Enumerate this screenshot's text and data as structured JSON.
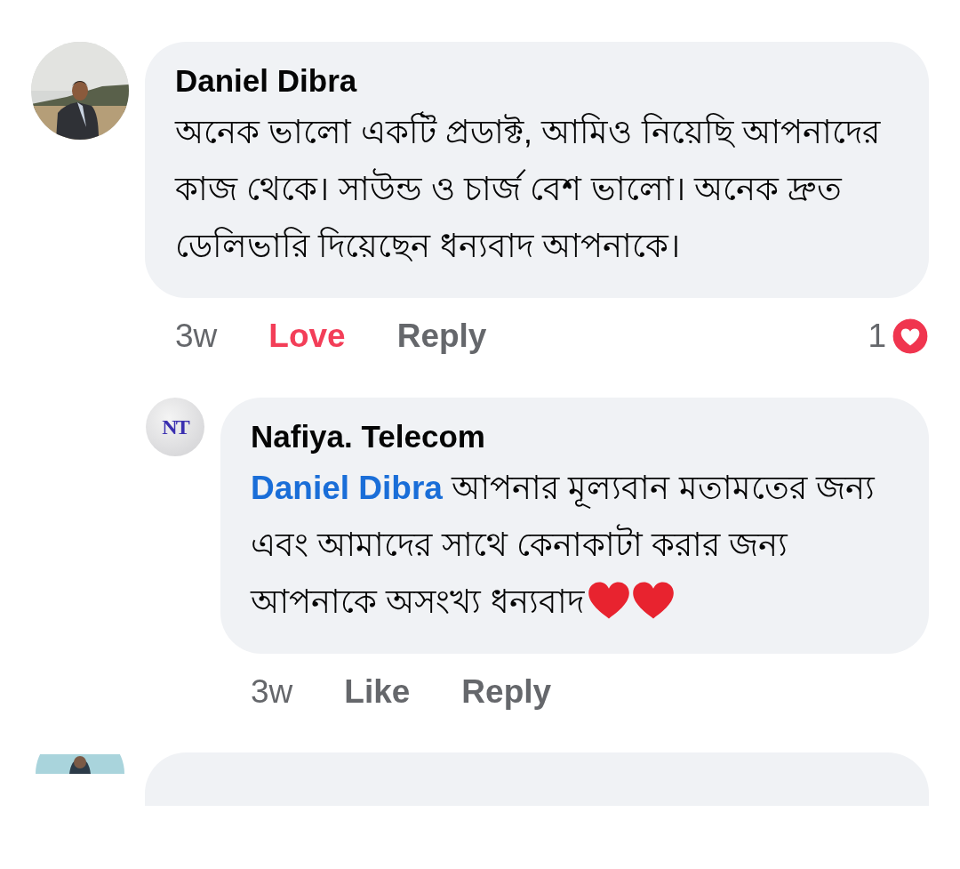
{
  "comment": {
    "author": "Daniel Dibra",
    "text": "অনেক ভালো একটি প্রডাক্ট, আমিও নিয়েছি আপনাদের কাজ থেকে। সাউন্ড ও চার্জ বেশ ভালো। অনেক দ্রুত ডেলিভারি দিয়েছেন ধন্যবাদ আপনাকে।",
    "time": "3w",
    "reaction": {
      "label": "Love",
      "selected": true
    },
    "reply_label": "Reply",
    "reaction_count": "1",
    "replies": [
      {
        "author": "Nafiya. Telecom",
        "avatar": {
          "kind": "logo",
          "logo_text": "NT"
        },
        "mention": "Daniel Dibra",
        "text": "আপনার মূল্যবান মতামতের জন্য এবং আমাদের সাথে কেনাকাটা করার জন্য আপনাকে অসংখ্য ধন্যবাদ",
        "trailing_icons": [
          {
            "kind": "heart"
          },
          {
            "kind": "heart"
          }
        ],
        "time": "3w",
        "reaction": {
          "label": "Like",
          "selected": false
        },
        "reply_label": "Reply"
      }
    ]
  }
}
